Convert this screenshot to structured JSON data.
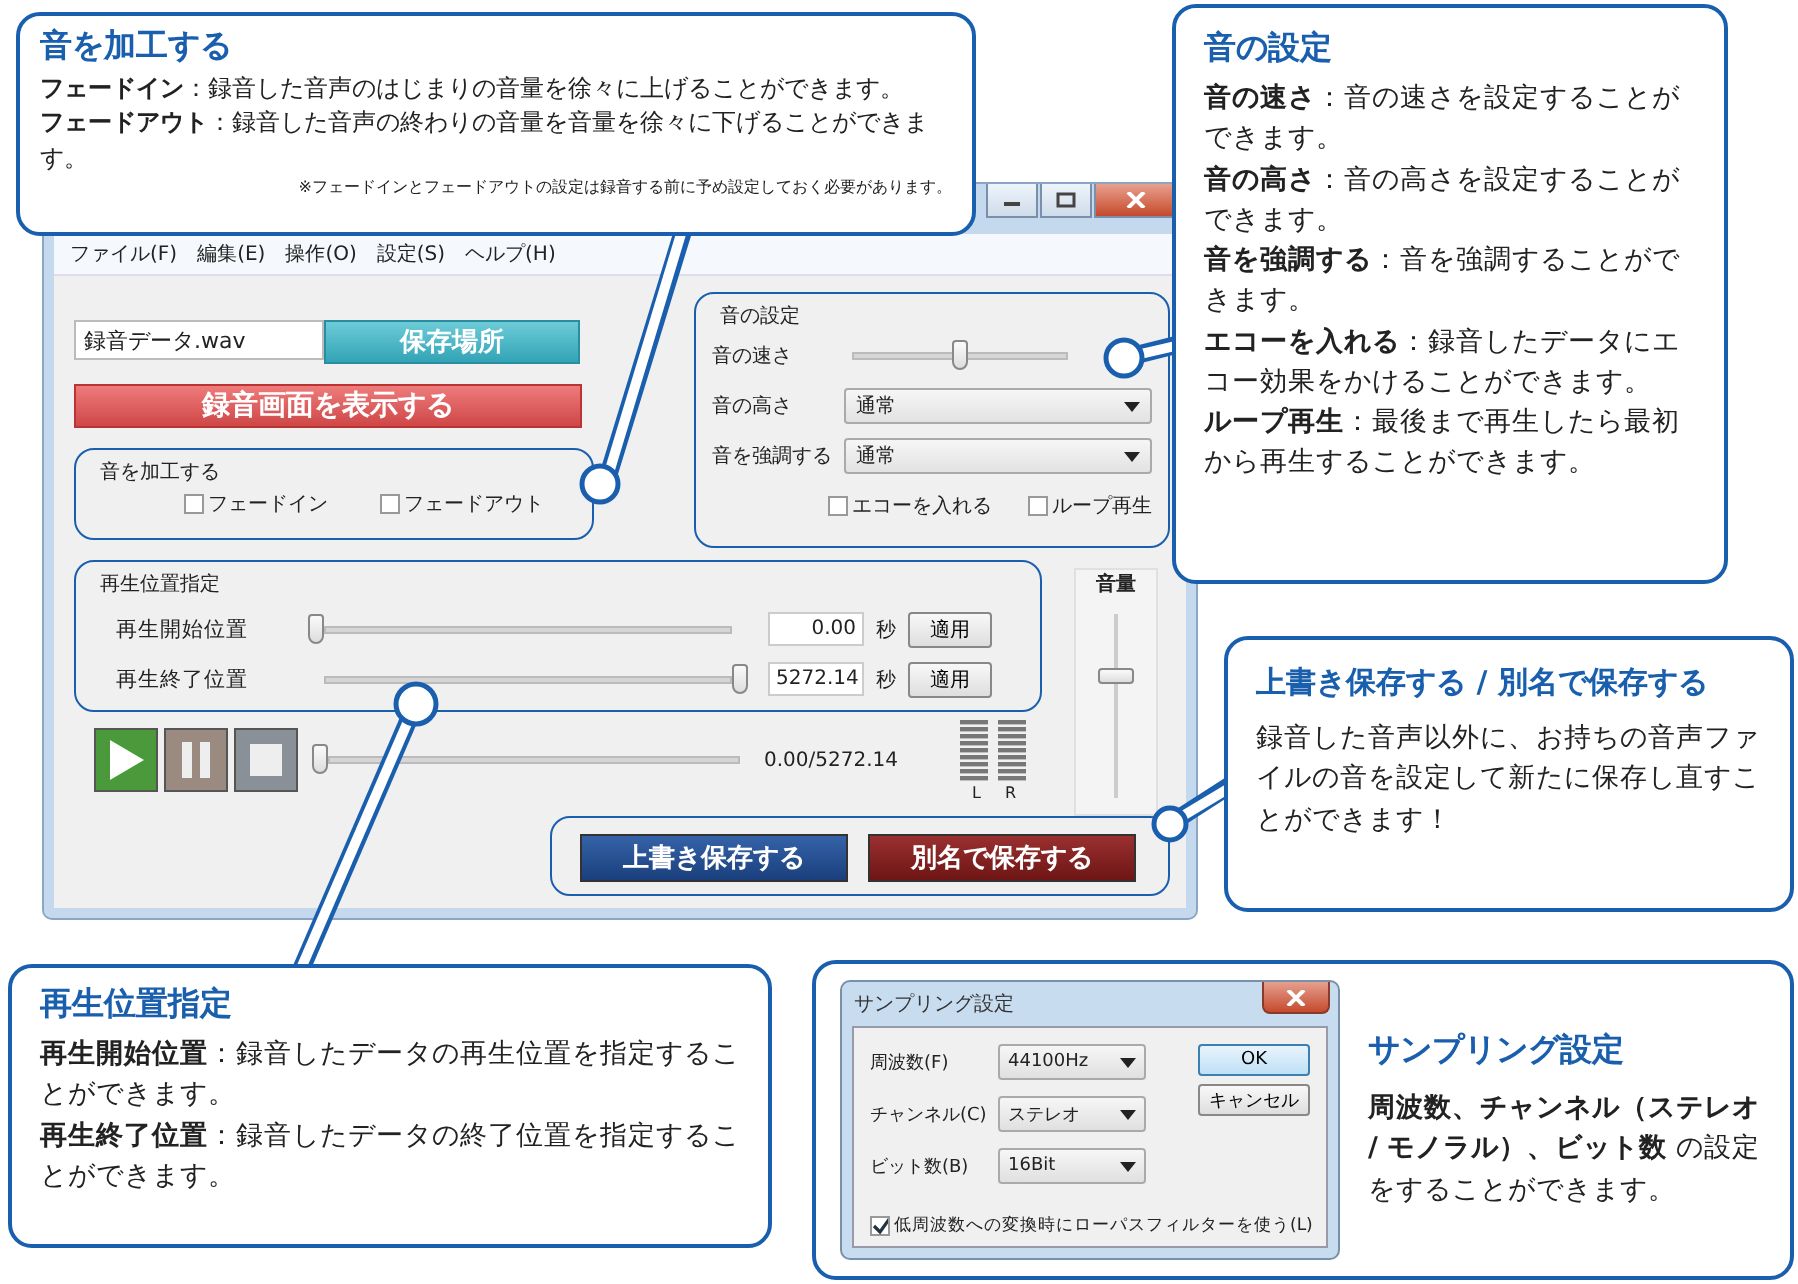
{
  "window": {
    "menu": [
      "ファイル(F)",
      "編集(E)",
      "操作(O)",
      "設定(S)",
      "ヘルプ(H)"
    ],
    "file_name": "録音データ.wav",
    "save_location_button": "保存場所",
    "record_screen_button": "録音画面を表示する",
    "fade_group": {
      "title": "音を加工する",
      "options": [
        {
          "label": "フェードイン",
          "checked": false
        },
        {
          "label": "フェードアウト",
          "checked": false
        }
      ]
    },
    "sound_settings": {
      "title": "音の設定",
      "speed": {
        "label": "音の速さ",
        "level": 0.5
      },
      "selects": [
        {
          "label": "音の高さ",
          "value": "通常"
        },
        {
          "label": "音を強調する",
          "value": "通常"
        }
      ],
      "options": [
        {
          "label": "エコーを入れる",
          "checked": false
        },
        {
          "label": "ループ再生",
          "checked": false
        }
      ]
    },
    "position": {
      "title": "再生位置指定",
      "rows": [
        {
          "label": "再生開始位置",
          "level": 0,
          "value": "0.00",
          "unit": "秒",
          "button": "適用"
        },
        {
          "label": "再生終了位置",
          "level": 1,
          "value": "5272.14",
          "unit": "秒",
          "button": "適用"
        }
      ]
    },
    "transport": {
      "level": 0,
      "time": "0.00/5272.14"
    },
    "meter_labels": [
      "L",
      "R"
    ],
    "volume": {
      "title": "音量",
      "level": 0.65
    },
    "save_buttons": [
      "上書き保存する",
      "別名で保存する"
    ]
  },
  "fade_callout": {
    "title": "音を加工する",
    "paragraphs": [
      "**フェードイン**：録音した音声のはじまりの音量を徐々に上げることができます。",
      "**フェードアウト**：録音した音声の終わりの音量を音量を徐々に下げることができます。"
    ],
    "note": "※フェードインとフェードアウトの設定は録音する前に予め設定しておく必要があります。"
  },
  "sound_callout": {
    "title": "音の設定",
    "paragraphs": [
      "**音の速さ**：音の速さを設定することができます。",
      "**音の高さ**：音の高さを設定することができます。",
      "**音を強調する**：音を強調することができます。",
      "**エコーを入れる**：録音したデータにエコー効果をかけることができます。",
      "**ループ再生**：最後まで再生したら最初から再生することができます。"
    ]
  },
  "save_callout": {
    "title": "上書き保存する / 別名で保存する",
    "paragraphs": [
      "録音した音声以外に、お持ちの音声ファイルの音を設定して新たに保存し直すことができます！"
    ]
  },
  "position_callout": {
    "title": "再生位置指定",
    "paragraphs": [
      "**再生開始位置**：録音したデータの再生位置を指定することができます。",
      "**再生終了位置**：録音したデータの終了位置を指定することができます。"
    ]
  },
  "sampling_callout": {
    "title": "サンプリング設定",
    "paragraphs": [
      "**周波数、チャンネル（ステレオ / モノラル）、ビット数** の設定をすることができます。"
    ],
    "dialog": {
      "title": "サンプリング設定",
      "fields": [
        {
          "label": "周波数(F)",
          "value": "44100Hz"
        },
        {
          "label": "チャンネル(C)",
          "value": "ステレオ"
        },
        {
          "label": "ビット数(B)",
          "value": "16Bit"
        }
      ],
      "checkbox": {
        "label": "低周波数への変換時にローパスフィルターを使う(L)",
        "checked": true
      },
      "buttons": [
        "OK",
        "キャンセル"
      ]
    }
  }
}
